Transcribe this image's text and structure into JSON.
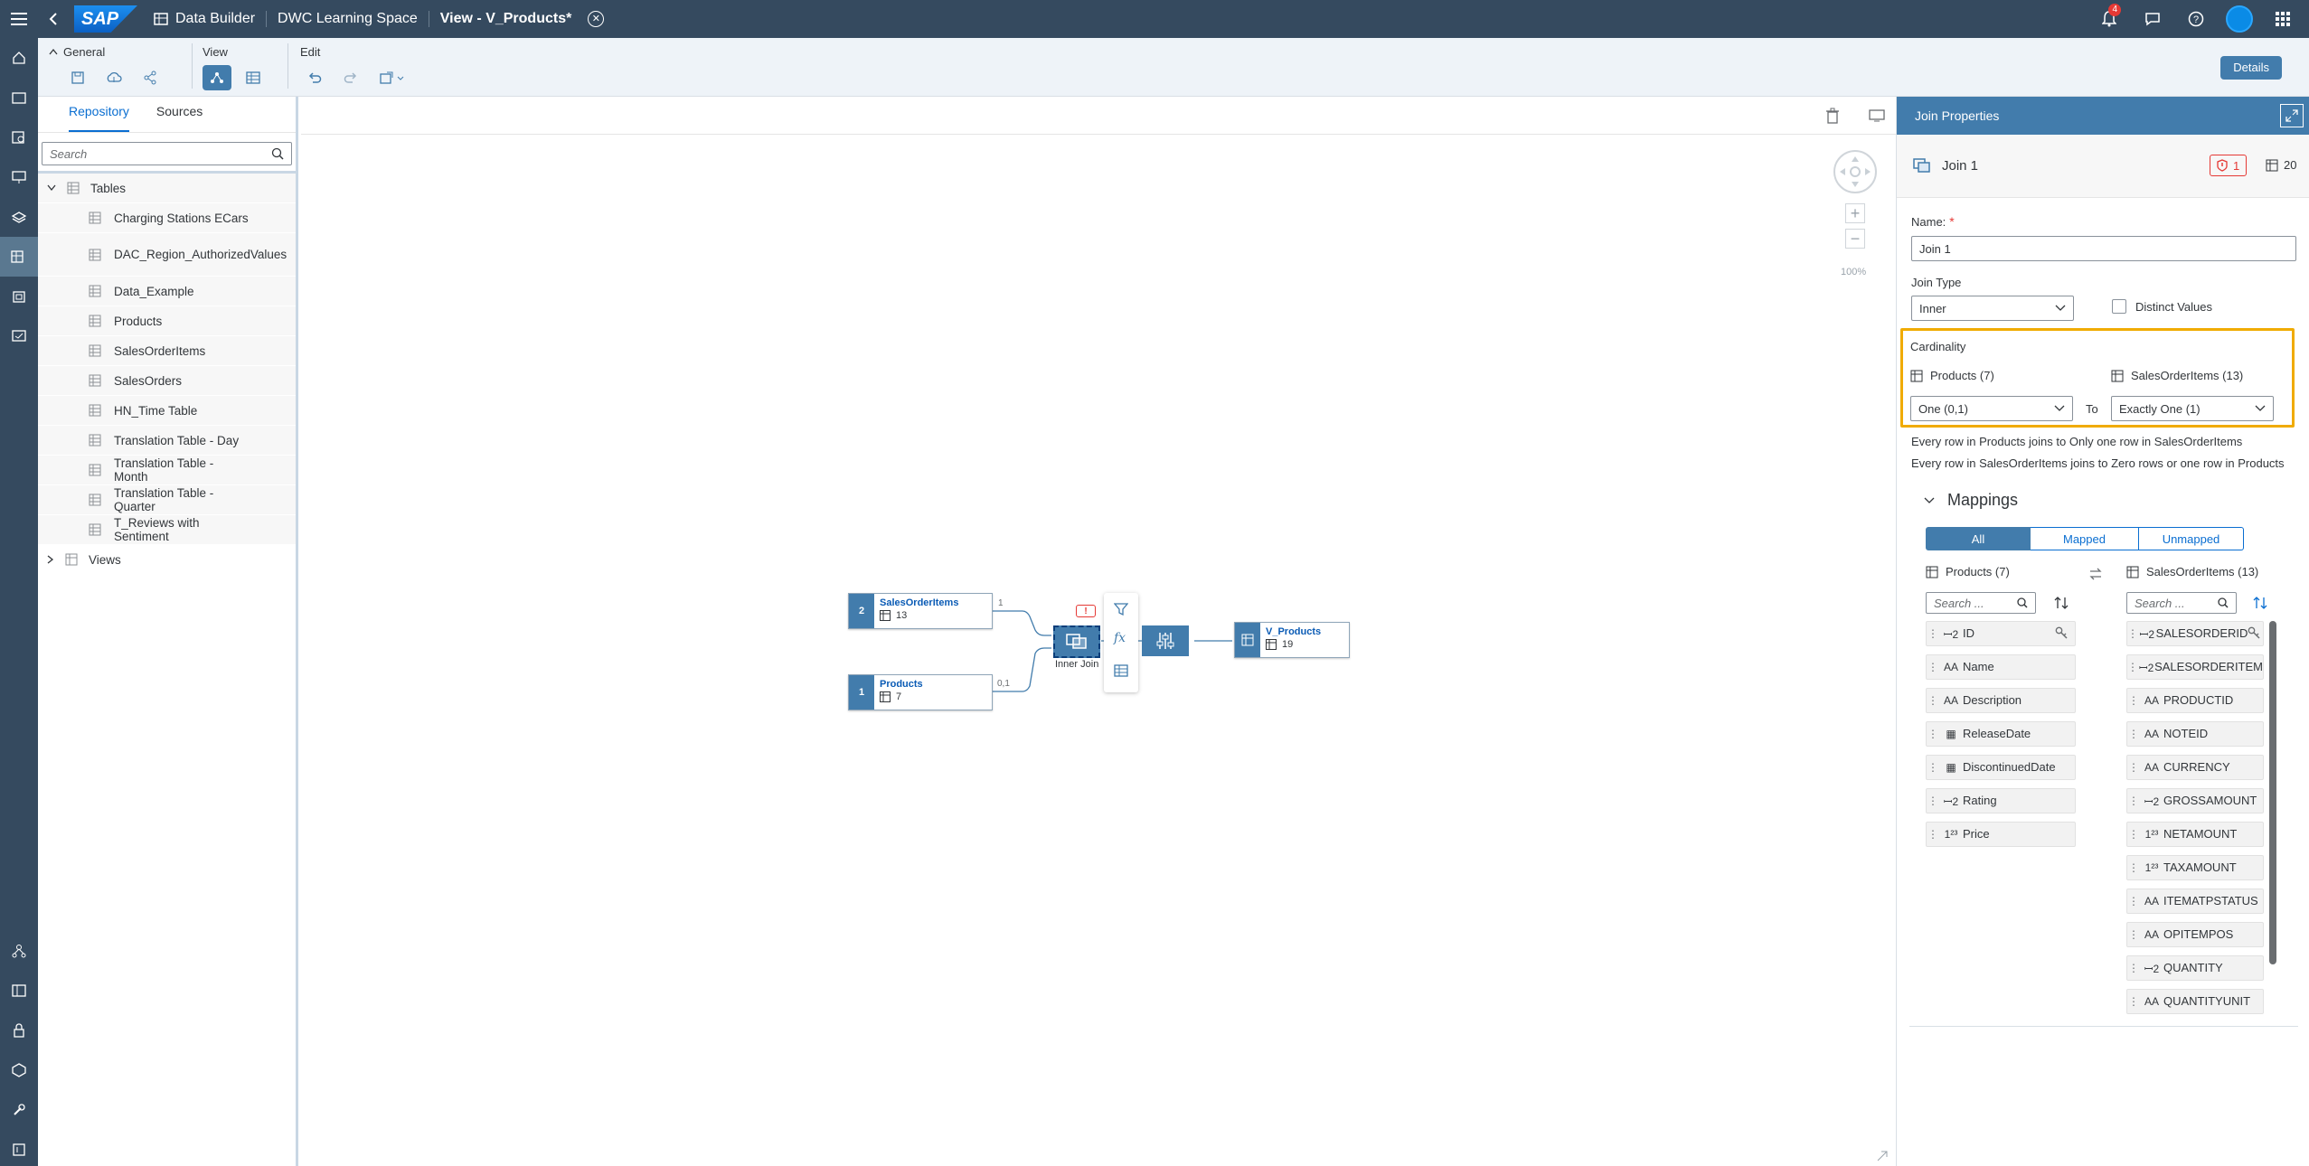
{
  "shell": {
    "logo": "SAP",
    "crumbs": [
      "Data Builder",
      "DWC Learning Space",
      "View - V_Products*"
    ],
    "notifications": "4"
  },
  "toolbar": {
    "general": "General",
    "view": "View",
    "edit": "Edit",
    "details": "Details"
  },
  "repo": {
    "tabs": [
      "Repository",
      "Sources"
    ],
    "search_placeholder": "Search",
    "tables_label": "Tables",
    "items": [
      "Charging Stations ECars",
      "DAC_Region_AuthorizedValues",
      "Data_Example",
      "Products",
      "SalesOrderItems",
      "SalesOrders",
      "HN_Time Table",
      "Translation Table - Day",
      "Translation Table - Month",
      "Translation Table - Quarter",
      "T_Reviews with Sentiment"
    ],
    "views_label": "Views"
  },
  "canvas": {
    "zoom": "100%",
    "node1": {
      "num": "2",
      "name": "SalesOrderItems",
      "count": "13",
      "card": "1"
    },
    "node2": {
      "num": "1",
      "name": "Products",
      "count": "7",
      "card": "0,1"
    },
    "join_label": "Inner Join",
    "output": {
      "name": "V_Products",
      "count": "19"
    }
  },
  "props": {
    "title": "Join Properties",
    "join_name": "Join 1",
    "error_count": "1",
    "col_count": "20",
    "name_label": "Name:",
    "name_required": "*",
    "name_value": "Join 1",
    "join_type_label": "Join Type",
    "join_type_value": "Inner",
    "distinct_label": "Distinct Values",
    "cardinality_label": "Cardinality",
    "left_entity": "Products (7)",
    "right_entity": "SalesOrderItems (13)",
    "left_card": "One (0,1)",
    "to_label": "To",
    "right_card": "Exactly One (1)",
    "desc1": "Every row in Products joins to Only one row in SalesOrderItems",
    "desc2": "Every row in SalesOrderItems joins to Zero rows or one row in Products",
    "mappings_label": "Mappings",
    "seg": [
      "All",
      "Mapped",
      "Unmapped"
    ],
    "search_placeholder": "Search ...",
    "left_cols": [
      {
        "type": "ꟷ2",
        "name": "ID"
      },
      {
        "type": "AA",
        "name": "Name"
      },
      {
        "type": "AA",
        "name": "Description"
      },
      {
        "type": "▦",
        "name": "ReleaseDate"
      },
      {
        "type": "▦",
        "name": "DiscontinuedDate"
      },
      {
        "type": "ꟷ2",
        "name": "Rating"
      },
      {
        "type": "1²³",
        "name": "Price"
      }
    ],
    "right_cols": [
      {
        "type": "ꟷ2",
        "name": "SALESORDERID"
      },
      {
        "type": "ꟷ2",
        "name": "SALESORDERITEM"
      },
      {
        "type": "AA",
        "name": "PRODUCTID"
      },
      {
        "type": "AA",
        "name": "NOTEID"
      },
      {
        "type": "AA",
        "name": "CURRENCY"
      },
      {
        "type": "ꟷ2",
        "name": "GROSSAMOUNT"
      },
      {
        "type": "1²³",
        "name": "NETAMOUNT"
      },
      {
        "type": "1²³",
        "name": "TAXAMOUNT"
      },
      {
        "type": "AA",
        "name": "ITEMATPSTATUS"
      },
      {
        "type": "AA",
        "name": "OPITEMPOS"
      },
      {
        "type": "ꟷ2",
        "name": "QUANTITY"
      },
      {
        "type": "AA",
        "name": "QUANTITYUNIT"
      }
    ]
  }
}
